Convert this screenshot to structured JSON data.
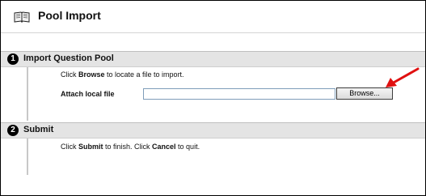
{
  "header": {
    "title": "Pool Import",
    "icon": "book-icon"
  },
  "steps": [
    {
      "number": "1",
      "title": "Import Question Pool",
      "instruction": {
        "pre": "Click ",
        "bold": "Browse",
        "post": " to locate a file to import."
      },
      "field_label": "Attach local file",
      "file_value": "",
      "browse_label": "Browse..."
    },
    {
      "number": "2",
      "title": "Submit",
      "instruction": {
        "pre": "Click ",
        "bold1": "Submit",
        "mid": " to finish. Click ",
        "bold2": "Cancel",
        "post": " to quit."
      }
    }
  ],
  "annotation": {
    "arrow_color": "#e01010",
    "icon": "red-arrow-icon"
  },
  "colors": {
    "step_header_bg": "#e4e4e4",
    "input_border": "#7f9db9"
  }
}
